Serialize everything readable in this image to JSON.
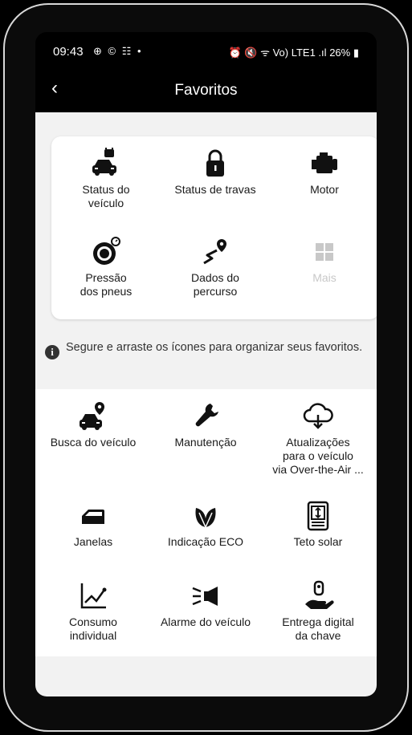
{
  "status_bar": {
    "time": "09:43",
    "left_icons": "⊕ © ☷ •",
    "right_icons": "⏰ 🔇 ᯤ Vo) LTE1 .ıl",
    "battery": "26%"
  },
  "appbar": {
    "title": "Favoritos",
    "back_icon": "‹"
  },
  "favorites": [
    {
      "label": "Status do\nveículo",
      "icon": "car-lock-icon"
    },
    {
      "label": "Status de travas",
      "icon": "lock-icon"
    },
    {
      "label": "Motor",
      "icon": "engine-icon"
    },
    {
      "label": "Pressão\ndos pneus",
      "icon": "tire-pressure-icon"
    },
    {
      "label": "Dados do\npercurso",
      "icon": "route-icon"
    },
    {
      "label": "Mais",
      "icon": "grid-icon"
    }
  ],
  "hint": {
    "icon": "info-icon",
    "text": "Segure e arraste os ícones para organizar seus favoritos."
  },
  "all_features": [
    {
      "label": "Busca do veículo",
      "icon": "car-location-icon"
    },
    {
      "label": "Manutenção",
      "icon": "wrench-icon"
    },
    {
      "label": "Atualizações\npara o veículo\nvia Over-the-Air ...",
      "icon": "cloud-download-icon"
    },
    {
      "label": "Janelas",
      "icon": "car-window-icon"
    },
    {
      "label": "Indicação ECO",
      "icon": "leaf-icon"
    },
    {
      "label": "Teto solar",
      "icon": "sunroof-icon"
    },
    {
      "label": "Consumo\nindividual",
      "icon": "chart-icon"
    },
    {
      "label": "Alarme do veículo",
      "icon": "horn-icon"
    },
    {
      "label": "Entrega digital\nda chave",
      "icon": "hand-key-icon"
    }
  ]
}
